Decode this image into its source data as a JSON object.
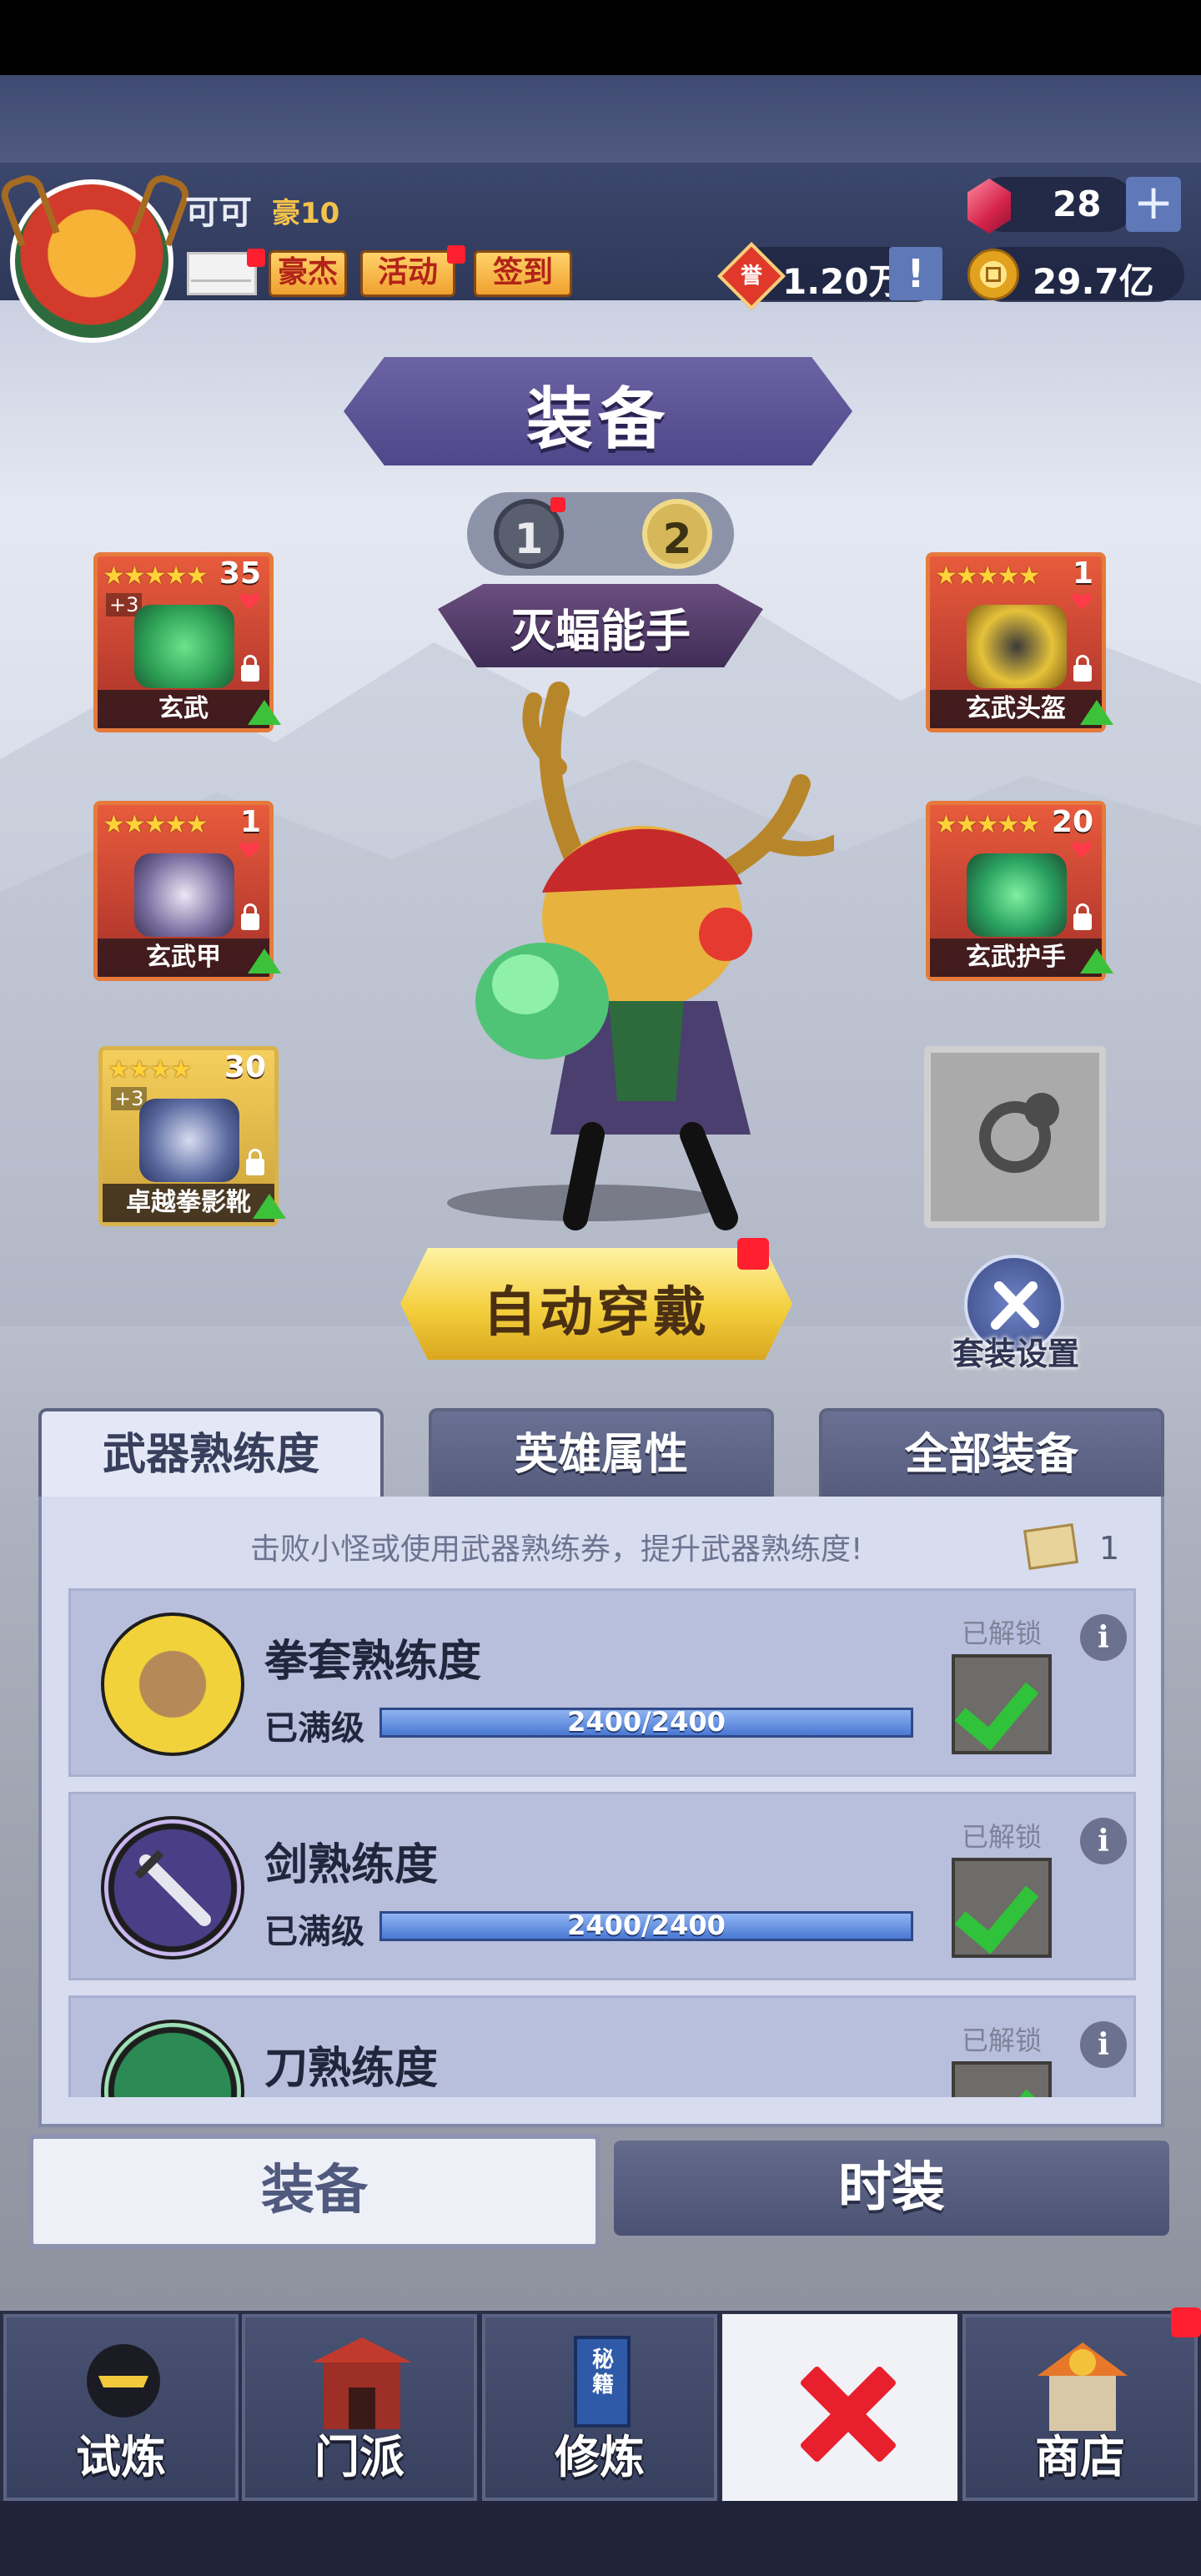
{
  "header": {
    "player_name": "可可",
    "vip_label": "豪10",
    "buttons": [
      "豪杰",
      "活动",
      "签到"
    ],
    "gems": "28",
    "honor": "1.20万",
    "gold": "29.7亿",
    "honor_glyph": "誉"
  },
  "title": "装备",
  "page_switch": {
    "pages": [
      "1",
      "2"
    ],
    "selected": "2"
  },
  "hero_title": "灭蝠能手",
  "slots": [
    {
      "label": "玄武",
      "stars": "★★★★★",
      "level": "35",
      "plus": "+3",
      "rarity": "red"
    },
    {
      "label": "玄武甲",
      "stars": "★★★★★",
      "level": "1",
      "plus": "",
      "rarity": "red"
    },
    {
      "label": "卓越拳影靴",
      "stars": "★★★★",
      "level": "30",
      "plus": "+3",
      "rarity": "gold"
    },
    {
      "label": "玄武头盔",
      "stars": "★★★★★",
      "level": "1",
      "plus": "",
      "rarity": "red"
    },
    {
      "label": "玄武护手",
      "stars": "★★★★★",
      "level": "20",
      "plus": "",
      "rarity": "red"
    }
  ],
  "auto_equip_label": "自动穿戴",
  "suit_settings_label": "套装设置",
  "tabs": [
    "武器熟练度",
    "英雄属性",
    "全部装备"
  ],
  "active_tab": "武器熟练度",
  "hint": "击败小怪或使用武器熟练券，提升武器熟练度!",
  "ticket_count": "1",
  "proficiency": [
    {
      "name": "拳套熟练度",
      "status": "已满级",
      "progress": "2400/2400",
      "progress_ratio": 1.0,
      "unlock": "已解锁",
      "icon": "fist-glove-icon"
    },
    {
      "name": "剑熟练度",
      "status": "已满级",
      "progress": "2400/2400",
      "progress_ratio": 1.0,
      "unlock": "已解锁",
      "icon": "sword-icon"
    },
    {
      "name": "刀熟练度",
      "status": "",
      "progress": "",
      "progress_ratio": null,
      "unlock": "已解锁",
      "icon": "blade-icon"
    }
  ],
  "bottom_tabs": [
    "装备",
    "时装"
  ],
  "nav": [
    "试炼",
    "门派",
    "修炼",
    "",
    "商店"
  ],
  "nav_book_text": "秘籍",
  "colors": {
    "accent_purple": "#4e4789",
    "slot_red": "#e85b3c",
    "slot_gold": "#f5cf5c",
    "check_green": "#2fc23a",
    "bar_blue": "#4a78d4"
  }
}
